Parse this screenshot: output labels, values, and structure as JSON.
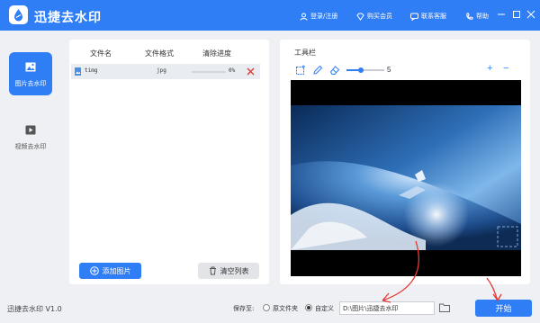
{
  "app": {
    "title": "迅捷去水印",
    "version": "迅捷去水印 V1.0"
  },
  "titlebar": {
    "links": [
      {
        "label": "登录/注册",
        "icon": "user-icon"
      },
      {
        "label": "购买会员",
        "icon": "diamond-icon"
      },
      {
        "label": "联系客服",
        "icon": "chat-icon"
      },
      {
        "label": "帮助",
        "icon": "phone-icon"
      }
    ]
  },
  "sidebar": {
    "items": [
      {
        "label": "图片去水印",
        "icon": "image-icon",
        "active": true
      },
      {
        "label": "视频去水印",
        "icon": "video-icon",
        "active": false
      }
    ]
  },
  "file_table": {
    "headers": [
      "文件名",
      "文件格式",
      "清除进度"
    ],
    "rows": [
      {
        "name": "timg",
        "format": "jpg",
        "progress_text": "0%",
        "progress": 0
      }
    ],
    "add_button": "添加图片",
    "clear_button": "清空列表"
  },
  "tools": {
    "title": "工具栏",
    "brush_size": "5",
    "brush_fraction": 0.38,
    "zoom_in": "+",
    "zoom_out": "−"
  },
  "save": {
    "label": "保存至:",
    "options": [
      "原文件夹",
      "自定义"
    ],
    "selected": "自定义",
    "path": "D:\\图片\\迅捷去水印"
  },
  "start_button": "开始",
  "colors": {
    "accent": "#2f7ef6",
    "annotation": "#e53935",
    "delete": "#e53935"
  }
}
